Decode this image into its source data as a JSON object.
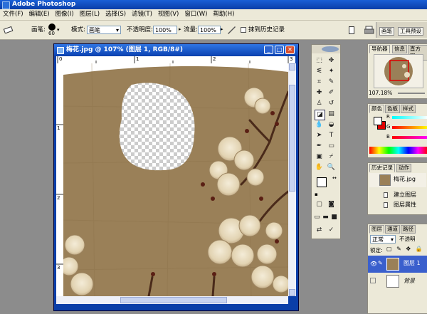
{
  "app": {
    "title": "Adobe Photoshop"
  },
  "menu": [
    "文件(F)",
    "编辑(E)",
    "图像(I)",
    "图层(L)",
    "选择(S)",
    "滤镜(T)",
    "视图(V)",
    "窗口(W)",
    "帮助(H)"
  ],
  "options": {
    "brush_label": "画笔:",
    "brush_size": "60",
    "mode_label": "模式:",
    "mode_value": "画笔",
    "opacity_label": "不透明度:",
    "opacity_value": "100%",
    "flow_label": "流量:",
    "flow_value": "100%",
    "erase_history_label": "抹到历史记录",
    "well_tabs": [
      "画笔",
      "工具预设"
    ]
  },
  "document": {
    "title": "梅花.jpg @ 107% (图层 1, RGB/8#)",
    "ruler_marks_h": [
      "0",
      "1",
      "2",
      "3"
    ],
    "ruler_marks_v": [
      "1",
      "2",
      "3"
    ]
  },
  "navigator": {
    "tabs": [
      "导航器",
      "信息",
      "直方图"
    ],
    "zoom": "107.18%"
  },
  "color": {
    "tabs": [
      "颜色",
      "色板",
      "样式"
    ],
    "labels": [
      "R",
      "G",
      "B"
    ],
    "fg": "#ffffff",
    "bg": "#e00000"
  },
  "history": {
    "tabs": [
      "历史记录",
      "动作"
    ],
    "snapshot": "梅花.jpg",
    "items": [
      "建立图层",
      "图层属性"
    ]
  },
  "layers": {
    "tabs": [
      "图层",
      "通道",
      "路径"
    ],
    "blend_mode": "正常",
    "opacity_label": "不透明",
    "lock_label": "锁定:",
    "items": [
      "图层 1",
      "背景"
    ]
  }
}
